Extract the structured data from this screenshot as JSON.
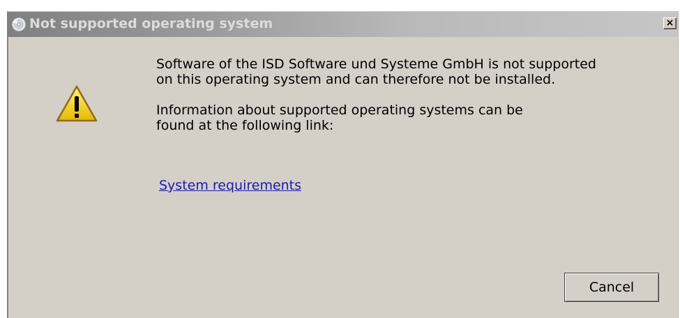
{
  "window": {
    "title": "Not supported operating system",
    "close_label": "×"
  },
  "message": {
    "line1": "Software of the ISD Software und Systeme GmbH is not supported",
    "line2": "on this operating system and can therefore not be installed.",
    "line3": "Information about supported operating systems can be",
    "line4": "found at the following link:"
  },
  "link": {
    "label": "System requirements"
  },
  "buttons": {
    "cancel_label": "Cancel"
  },
  "icons": {
    "title": "cd-installer-icon",
    "message": "warning-icon",
    "close": "close-icon"
  },
  "colors": {
    "dialog_background": "#d4d0c8",
    "titlebar_start": "#808080",
    "titlebar_end": "#c6c6c6",
    "link": "#1a1ab0",
    "warning_fill": "#f5d20a"
  }
}
